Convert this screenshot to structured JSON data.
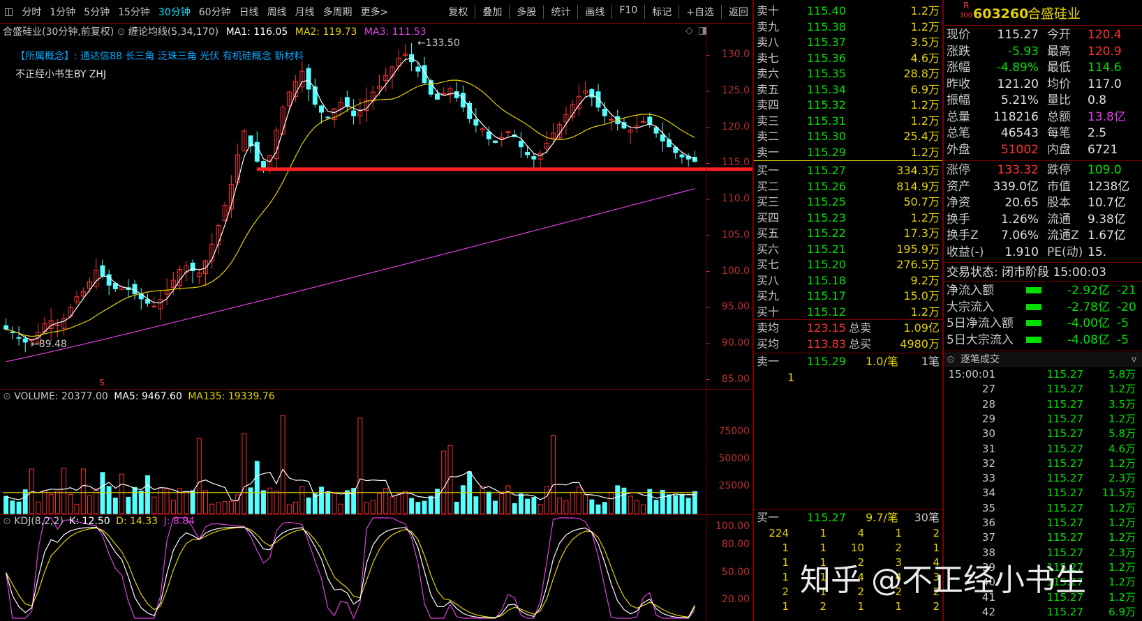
{
  "toolbar": {
    "left": [
      "分时",
      "1分钟",
      "5分钟",
      "15分钟",
      "30分钟",
      "60分钟",
      "日线",
      "周线",
      "月线",
      "多周期",
      "更多>"
    ],
    "active": "30分钟",
    "right": [
      "复权",
      "叠加",
      "多股",
      "统计",
      "画线",
      "F10",
      "标记",
      "+自选",
      "返回"
    ]
  },
  "chart": {
    "title": "合盛硅业(30分钟,前复权)",
    "indicator": "缠论均线(5,34,170)",
    "ma1": "MA1: 116.05",
    "ma2": "MA2: 119.73",
    "ma3": "MA3: 111.53",
    "concepts": "【所属概念】: 通达信88 长三角 泛珠三角 光伏 有机硅概念 新材料",
    "author": "不正经小书生BY ZHJ",
    "high_label": "133.50",
    "low_label": "89.48",
    "marker": "S",
    "y_ticks": [
      "130.0",
      "125.0",
      "120.0",
      "115.0",
      "110.0",
      "105.0",
      "100.0",
      "95.00",
      "90.00",
      "85.00"
    ],
    "volume_label": "VOLUME: 20377.00",
    "volume_ma5": "MA5: 9467.60",
    "volume_ma135": "MA135: 19339.76",
    "volume_ticks": [
      "75000",
      "50000",
      "25000"
    ],
    "kdj_label": "KDJ(8,2,2)",
    "kdj_k": "K: 12.50",
    "kdj_d": "D: 14.33",
    "kdj_j": "J: 8.84",
    "kdj_ticks": [
      "100.00",
      "80.00",
      "50.00",
      "20.00"
    ]
  },
  "chart_data": {
    "type": "candlestick",
    "ylim": [
      84,
      134
    ],
    "closes": [
      92,
      91.5,
      90.8,
      90.2,
      90.5,
      91.6,
      92.8,
      93.2,
      92.6,
      93.5,
      95,
      96.5,
      97.2,
      98.6,
      100.2,
      99.4,
      98.1,
      97.6,
      97.9,
      97.5,
      96.9,
      96.2,
      95.6,
      95.2,
      96.1,
      97.4,
      98.8,
      100.3,
      100.8,
      100.1,
      99.8,
      101.5,
      103.8,
      106.4,
      109.2,
      112.1,
      116.2,
      119.5,
      117.4,
      115.3,
      114.2,
      116.1,
      119.6,
      122.8,
      124.9,
      126.4,
      127.8,
      125.3,
      123.2,
      122.1,
      121.4,
      122.6,
      123.5,
      122.9,
      121.6,
      122.4,
      123.8,
      124.9,
      125.7,
      127.2,
      128.4,
      129.6,
      130.2,
      129.1,
      127.8,
      126.2,
      124.6,
      123.9,
      124.7,
      125.4,
      124.1,
      122.8,
      121.2,
      120.3,
      119.8,
      118.4,
      117.9,
      118.6,
      119.4,
      118.7,
      117.3,
      116.2,
      115.6,
      116.4,
      117.8,
      119.2,
      120.4,
      121.8,
      123.2,
      124.3,
      125.1,
      124.2,
      122.8,
      121.6,
      121.1,
      120.5,
      119.9,
      119.6,
      120.2,
      120.8,
      120.4,
      119.2,
      118.1,
      117.3,
      116.5,
      115.9,
      115.6,
      115.27
    ],
    "volume_ylim": [
      0,
      100000
    ],
    "kdj_ylim": [
      0,
      110
    ]
  },
  "orderbook": {
    "sells": [
      {
        "name": "卖十",
        "price": "115.40",
        "vol": "1.2万"
      },
      {
        "name": "卖九",
        "price": "115.38",
        "vol": "1.2万"
      },
      {
        "name": "卖八",
        "price": "115.37",
        "vol": "3.5万"
      },
      {
        "name": "卖七",
        "price": "115.36",
        "vol": "4.6万"
      },
      {
        "name": "卖六",
        "price": "115.35",
        "vol": "28.8万"
      },
      {
        "name": "卖五",
        "price": "115.34",
        "vol": "6.9万"
      },
      {
        "name": "卖四",
        "price": "115.32",
        "vol": "1.2万"
      },
      {
        "name": "卖三",
        "price": "115.31",
        "vol": "1.2万"
      },
      {
        "name": "卖二",
        "price": "115.30",
        "vol": "25.4万"
      },
      {
        "name": "卖一",
        "price": "115.29",
        "vol": "1.2万"
      }
    ],
    "buys": [
      {
        "name": "买一",
        "price": "115.27",
        "vol": "334.3万"
      },
      {
        "name": "买二",
        "price": "115.26",
        "vol": "814.9万"
      },
      {
        "name": "买三",
        "price": "115.25",
        "vol": "50.7万"
      },
      {
        "name": "买四",
        "price": "115.23",
        "vol": "1.2万"
      },
      {
        "name": "买五",
        "price": "115.22",
        "vol": "17.3万"
      },
      {
        "name": "买六",
        "price": "115.21",
        "vol": "195.9万"
      },
      {
        "name": "买七",
        "price": "115.20",
        "vol": "276.5万"
      },
      {
        "name": "买八",
        "price": "115.18",
        "vol": "9.2万"
      },
      {
        "name": "买九",
        "price": "115.17",
        "vol": "15.0万"
      },
      {
        "name": "买十",
        "price": "115.12",
        "vol": "1.2万"
      }
    ],
    "avg_sell_label": "卖均",
    "avg_sell_price": "123.15",
    "total_sell_label": "总卖",
    "total_sell": "1.09亿",
    "avg_buy_label": "买均",
    "avg_buy_price": "113.83",
    "total_buy_label": "总买",
    "total_buy": "4980万",
    "queue_sell": {
      "name": "卖一",
      "price": "115.29",
      "per": "1.0/笔",
      "count": "1笔",
      "first": "1"
    },
    "queue_buy": {
      "name": "买一",
      "price": "115.27",
      "per": "9.7/笔",
      "count": "30笔"
    },
    "queue_grid": [
      [
        "224",
        "1",
        "4",
        "1",
        "2"
      ],
      [
        "1",
        "1",
        "10",
        "2",
        "1"
      ],
      [
        "1",
        "1",
        "2",
        "3",
        "4"
      ],
      [
        "1",
        "1",
        "4",
        "4",
        "3"
      ],
      [
        "2",
        "1",
        "2",
        "2",
        "2"
      ],
      [
        "1",
        "2",
        "1",
        "1",
        "2"
      ]
    ]
  },
  "stock": {
    "badge": "R",
    "badge_sub": "300",
    "code": "603260",
    "name": "合盛硅业",
    "rows": [
      [
        "现价",
        "115.27",
        "今开",
        "120.4"
      ],
      [
        "涨跌",
        "-5.93",
        "最高",
        "120.9"
      ],
      [
        "涨幅",
        "-4.89%",
        "最低",
        "114.6"
      ],
      [
        "昨收",
        "121.20",
        "均价",
        "117.0"
      ],
      [
        "振幅",
        "5.21%",
        "量比",
        "0.8"
      ],
      [
        "总量",
        "118216",
        "总额",
        "13.8亿"
      ],
      [
        "总笔",
        "46543",
        "每笔",
        "2.5"
      ],
      [
        "外盘",
        "51002",
        "内盘",
        "6721"
      ]
    ],
    "rows2": [
      [
        "涨停",
        "133.32",
        "跌停",
        "109.0"
      ],
      [
        "资产",
        "339.0亿",
        "市值",
        "1238亿"
      ],
      [
        "净资",
        "20.65",
        "股本",
        "10.7亿"
      ],
      [
        "换手",
        "1.26%",
        "流通",
        "9.38亿"
      ],
      [
        "换手Z",
        "7.06%",
        "流通Z",
        "1.67亿"
      ],
      [
        "收益(-)",
        "1.910",
        "PE(动)",
        "15."
      ]
    ],
    "trade_status": "交易状态: 闭市阶段 15:00:03",
    "flows": [
      {
        "label": "净流入额",
        "value": "-2.92亿",
        "pct": "-21"
      },
      {
        "label": "大宗流入",
        "value": "-2.78亿",
        "pct": "-20"
      },
      {
        "label": "5日净流入额",
        "value": "-4.00亿",
        "pct": "-5"
      },
      {
        "label": "5日大宗流入",
        "value": "-4.08亿",
        "pct": "-5"
      }
    ],
    "ticks_title": "逐笔成交",
    "ticks": [
      {
        "t": "15:00:01",
        "p": "115.27",
        "v": "5.8万"
      },
      {
        "t": "27",
        "p": "115.27",
        "v": "1.2万"
      },
      {
        "t": "28",
        "p": "115.27",
        "v": "3.5万"
      },
      {
        "t": "29",
        "p": "115.27",
        "v": "1.2万"
      },
      {
        "t": "30",
        "p": "115.27",
        "v": "5.8万"
      },
      {
        "t": "31",
        "p": "115.27",
        "v": "4.6万"
      },
      {
        "t": "32",
        "p": "115.27",
        "v": "1.2万"
      },
      {
        "t": "33",
        "p": "115.27",
        "v": "2.3万"
      },
      {
        "t": "34",
        "p": "115.27",
        "v": "11.5万"
      },
      {
        "t": "35",
        "p": "115.27",
        "v": "1.2万"
      },
      {
        "t": "36",
        "p": "115.27",
        "v": "1.2万"
      },
      {
        "t": "37",
        "p": "115.27",
        "v": "1.2万"
      },
      {
        "t": "38",
        "p": "115.27",
        "v": "2.3万"
      },
      {
        "t": "39",
        "p": "115.27",
        "v": "1.2万"
      },
      {
        "t": "40",
        "p": "115.27",
        "v": "1.2万"
      },
      {
        "t": "41",
        "p": "115.27",
        "v": "1.2万"
      },
      {
        "t": "42",
        "p": "115.27",
        "v": "6.9万"
      }
    ]
  },
  "watermark": "知乎 @不正经小书生"
}
